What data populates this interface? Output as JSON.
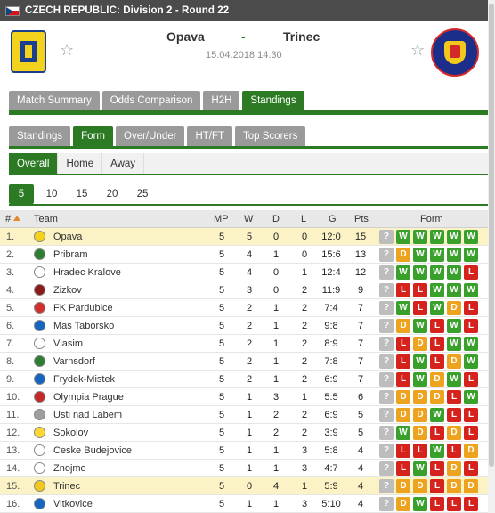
{
  "header": {
    "title": "CZECH REPUBLIC: Division 2 - Round 22"
  },
  "match": {
    "home_team": "Opava",
    "separator": "-",
    "away_team": "Trinec",
    "datetime": "15.04.2018 14:30"
  },
  "main_tabs": [
    "Match Summary",
    "Odds Comparison",
    "H2H",
    "Standings"
  ],
  "sub_tabs": [
    "Standings",
    "Form",
    "Over/Under",
    "HT/FT",
    "Top Scorers"
  ],
  "scope_tabs": [
    "Overall",
    "Home",
    "Away"
  ],
  "match_counts": [
    "5",
    "10",
    "15",
    "20",
    "25"
  ],
  "columns": {
    "rank": "#",
    "team": "Team",
    "mp": "MP",
    "w": "W",
    "d": "D",
    "l": "L",
    "g": "G",
    "pts": "Pts",
    "form": "Form"
  },
  "rows": [
    {
      "rank": "1.",
      "team": "Opava",
      "mp": "5",
      "w": "5",
      "d": "0",
      "l": "0",
      "g": "12:0",
      "pts": "15",
      "form": [
        "?",
        "W",
        "W",
        "W",
        "W",
        "W"
      ],
      "highlight": true
    },
    {
      "rank": "2.",
      "team": "Pribram",
      "mp": "5",
      "w": "4",
      "d": "1",
      "l": "0",
      "g": "15:6",
      "pts": "13",
      "form": [
        "?",
        "D",
        "W",
        "W",
        "W",
        "W"
      ],
      "highlight": false
    },
    {
      "rank": "3.",
      "team": "Hradec Kralove",
      "mp": "5",
      "w": "4",
      "d": "0",
      "l": "1",
      "g": "12:4",
      "pts": "12",
      "form": [
        "?",
        "W",
        "W",
        "W",
        "W",
        "L"
      ],
      "highlight": false
    },
    {
      "rank": "4.",
      "team": "Zizkov",
      "mp": "5",
      "w": "3",
      "d": "0",
      "l": "2",
      "g": "11:9",
      "pts": "9",
      "form": [
        "?",
        "L",
        "L",
        "W",
        "W",
        "W"
      ],
      "highlight": false
    },
    {
      "rank": "5.",
      "team": "FK Pardubice",
      "mp": "5",
      "w": "2",
      "d": "1",
      "l": "2",
      "g": "7:4",
      "pts": "7",
      "form": [
        "?",
        "W",
        "L",
        "W",
        "D",
        "L"
      ],
      "highlight": false
    },
    {
      "rank": "6.",
      "team": "Mas Taborsko",
      "mp": "5",
      "w": "2",
      "d": "1",
      "l": "2",
      "g": "9:8",
      "pts": "7",
      "form": [
        "?",
        "D",
        "W",
        "L",
        "W",
        "L"
      ],
      "highlight": false
    },
    {
      "rank": "7.",
      "team": "Vlasim",
      "mp": "5",
      "w": "2",
      "d": "1",
      "l": "2",
      "g": "8:9",
      "pts": "7",
      "form": [
        "?",
        "L",
        "D",
        "L",
        "W",
        "W"
      ],
      "highlight": false
    },
    {
      "rank": "8.",
      "team": "Varnsdorf",
      "mp": "5",
      "w": "2",
      "d": "1",
      "l": "2",
      "g": "7:8",
      "pts": "7",
      "form": [
        "?",
        "L",
        "W",
        "L",
        "D",
        "W"
      ],
      "highlight": false
    },
    {
      "rank": "9.",
      "team": "Frydek-Mistek",
      "mp": "5",
      "w": "2",
      "d": "1",
      "l": "2",
      "g": "6:9",
      "pts": "7",
      "form": [
        "?",
        "L",
        "W",
        "D",
        "W",
        "L"
      ],
      "highlight": false
    },
    {
      "rank": "10.",
      "team": "Olympia Prague",
      "mp": "5",
      "w": "1",
      "d": "3",
      "l": "1",
      "g": "5:5",
      "pts": "6",
      "form": [
        "?",
        "D",
        "D",
        "D",
        "L",
        "W"
      ],
      "highlight": false
    },
    {
      "rank": "11.",
      "team": "Usti nad Labem",
      "mp": "5",
      "w": "1",
      "d": "2",
      "l": "2",
      "g": "6:9",
      "pts": "5",
      "form": [
        "?",
        "D",
        "D",
        "W",
        "L",
        "L"
      ],
      "highlight": false
    },
    {
      "rank": "12.",
      "team": "Sokolov",
      "mp": "5",
      "w": "1",
      "d": "2",
      "l": "2",
      "g": "3:9",
      "pts": "5",
      "form": [
        "?",
        "W",
        "D",
        "L",
        "D",
        "L"
      ],
      "highlight": false
    },
    {
      "rank": "13.",
      "team": "Ceske Budejovice",
      "mp": "5",
      "w": "1",
      "d": "1",
      "l": "3",
      "g": "5:8",
      "pts": "4",
      "form": [
        "?",
        "L",
        "L",
        "W",
        "L",
        "D"
      ],
      "highlight": false
    },
    {
      "rank": "14.",
      "team": "Znojmo",
      "mp": "5",
      "w": "1",
      "d": "1",
      "l": "3",
      "g": "4:7",
      "pts": "4",
      "form": [
        "?",
        "L",
        "W",
        "L",
        "D",
        "L"
      ],
      "highlight": false
    },
    {
      "rank": "15.",
      "team": "Trinec",
      "mp": "5",
      "w": "0",
      "d": "4",
      "l": "1",
      "g": "5:9",
      "pts": "4",
      "form": [
        "?",
        "D",
        "D",
        "L",
        "D",
        "D"
      ],
      "highlight": true
    },
    {
      "rank": "16.",
      "team": "Vitkovice",
      "mp": "5",
      "w": "1",
      "d": "1",
      "l": "3",
      "g": "5:10",
      "pts": "4",
      "form": [
        "?",
        "D",
        "W",
        "L",
        "L",
        "L"
      ],
      "highlight": false
    }
  ],
  "colors": {
    "accent": "#2c7a23",
    "win": "#3aa02c",
    "draw": "#eda31e",
    "loss": "#d6221c",
    "unknown": "#bdbdbd",
    "highlight_row": "#fbf3c6"
  }
}
